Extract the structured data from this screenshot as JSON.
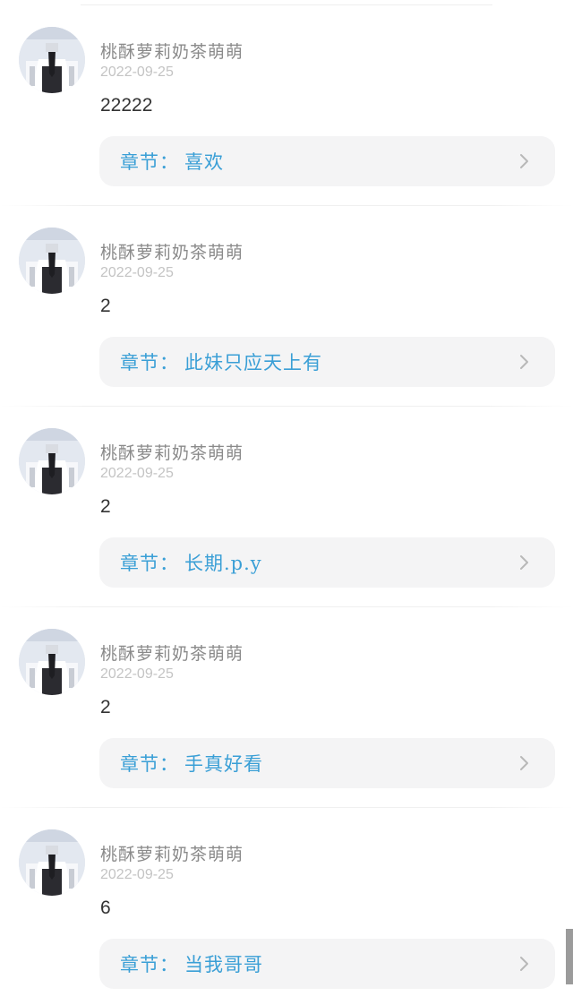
{
  "chapter_prefix": "章节：",
  "comments": [
    {
      "username": "桃酥萝莉奶茶萌萌",
      "date": "2022-09-25",
      "content": "22222",
      "chapter": "喜欢"
    },
    {
      "username": "桃酥萝莉奶茶萌萌",
      "date": "2022-09-25",
      "content": "2",
      "chapter": "此妹只应天上有"
    },
    {
      "username": "桃酥萝莉奶茶萌萌",
      "date": "2022-09-25",
      "content": "2",
      "chapter": "长期.p.y"
    },
    {
      "username": "桃酥萝莉奶茶萌萌",
      "date": "2022-09-25",
      "content": "2",
      "chapter": "手真好看"
    },
    {
      "username": "桃酥萝莉奶茶萌萌",
      "date": "2022-09-25",
      "content": "6",
      "chapter": "当我哥哥"
    }
  ],
  "colors": {
    "chapter_text": "#3a9fd6",
    "chapter_bg": "#f4f4f5",
    "username": "#8a8a8a",
    "date": "#c4c4c4"
  },
  "icons": {
    "avatar": "user-avatar-image",
    "chevron": "chevron-right-icon"
  }
}
